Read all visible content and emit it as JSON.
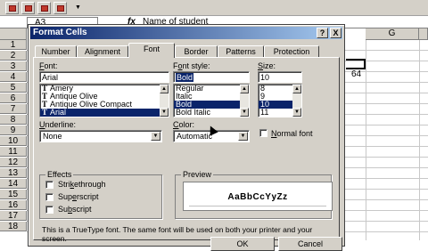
{
  "excel": {
    "name_box": "A3",
    "fx_symbol": "fx",
    "formula": "Name of student",
    "columns": [
      "G"
    ],
    "rows": [
      "1",
      "2",
      "3",
      "4",
      "5",
      "6",
      "7",
      "8",
      "9",
      "10",
      "11",
      "12",
      "13",
      "14",
      "15",
      "16",
      "17",
      "18"
    ],
    "cell_value": "64"
  },
  "dialog": {
    "title": "Format Cells",
    "help_btn": "?",
    "close_btn": "X",
    "tabs": [
      "Number",
      "Alignment",
      "Font",
      "Border",
      "Patterns",
      "Protection"
    ],
    "active_tab": "Font",
    "font": {
      "label_pre": "",
      "label_u": "F",
      "label_post": "ont:",
      "value": "Arial",
      "items": [
        {
          "name": "Amery",
          "tt": true
        },
        {
          "name": "Antique Olive",
          "tt": true
        },
        {
          "name": "Antique Olive Compact",
          "tt": true
        },
        {
          "name": "Arial",
          "tt": true,
          "selected": true
        }
      ]
    },
    "style": {
      "label_pre": "F",
      "label_u": "o",
      "label_post": "nt style:",
      "value": "Bold",
      "items": [
        {
          "name": "Regular"
        },
        {
          "name": "Italic"
        },
        {
          "name": "Bold",
          "selected": true
        },
        {
          "name": "Bold Italic"
        }
      ]
    },
    "size": {
      "label_pre": "",
      "label_u": "S",
      "label_post": "ize:",
      "value": "10",
      "items": [
        {
          "name": "8"
        },
        {
          "name": "9"
        },
        {
          "name": "10",
          "selected": true
        },
        {
          "name": "11"
        }
      ]
    },
    "underline": {
      "label_pre": "",
      "label_u": "U",
      "label_post": "nderline:",
      "value": "None"
    },
    "color": {
      "label_pre": "",
      "label_u": "C",
      "label_post": "olor:",
      "value": "Automatic"
    },
    "normal_font": {
      "label_pre": "",
      "label_u": "N",
      "label_post": "ormal font"
    },
    "effects": {
      "label": "Effects",
      "items": [
        {
          "pre": "Stri",
          "u": "k",
          "post": "ethrough"
        },
        {
          "pre": "Sup",
          "u": "e",
          "post": "rscript"
        },
        {
          "pre": "Su",
          "u": "b",
          "post": "script"
        }
      ]
    },
    "preview": {
      "label": "Preview",
      "sample": "AaBbCcYyZz"
    },
    "info": "This is a TrueType font.  The same font will be used on both your printer and your screen.",
    "ok_label": "OK",
    "cancel_label": "Cancel"
  }
}
